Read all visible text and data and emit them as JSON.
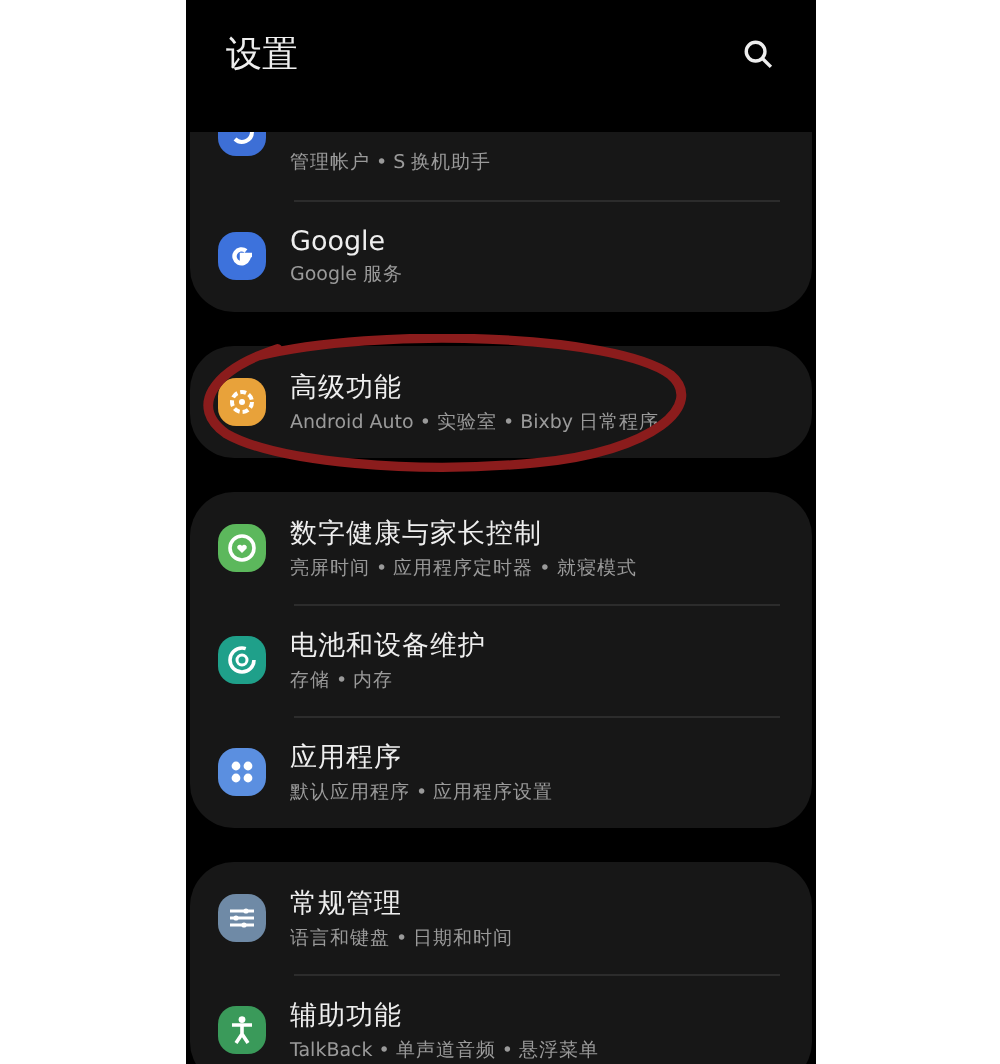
{
  "header": {
    "title": "设置"
  },
  "groups": [
    {
      "items": [
        {
          "subtitle": "管理帐户 • S 换机助手",
          "circled": false
        },
        {
          "title": "Google",
          "subtitle": "Google 服务",
          "circled": false
        }
      ]
    },
    {
      "items": [
        {
          "title": "高级功能",
          "subtitle": "Android Auto • 实验室 • Bixby 日常程序",
          "circled": true
        }
      ]
    },
    {
      "items": [
        {
          "title": "数字健康与家长控制",
          "subtitle": "亮屏时间 • 应用程序定时器 • 就寝模式",
          "circled": false
        },
        {
          "title": "电池和设备维护",
          "subtitle": "存储 • 内存",
          "circled": false
        },
        {
          "title": "应用程序",
          "subtitle": "默认应用程序 • 应用程序设置",
          "circled": false
        }
      ]
    },
    {
      "items": [
        {
          "title": "常规管理",
          "subtitle": "语言和键盘 • 日期和时间",
          "circled": false
        },
        {
          "title": "辅助功能",
          "subtitle": "TalkBack • 单声道音频 • 悬浮菜单",
          "circled": false
        }
      ]
    }
  ]
}
